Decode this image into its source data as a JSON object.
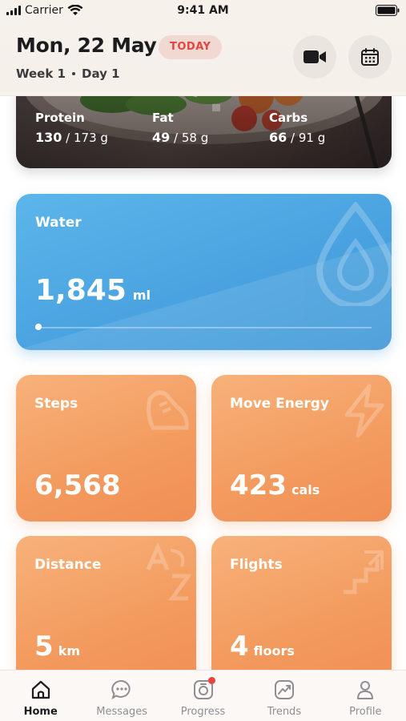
{
  "status_bar": {
    "carrier": "Carrier",
    "time": "9:41 AM"
  },
  "header": {
    "date": "Mon, 22 May",
    "today_badge": "TODAY",
    "week": "Week 1",
    "day": "Day 1"
  },
  "macros": [
    {
      "label": "Protein",
      "value": "130",
      "target": " / 173 g"
    },
    {
      "label": "Fat",
      "value": "49",
      "target": " / 58 g"
    },
    {
      "label": "Carbs",
      "value": "66",
      "target": " / 91 g"
    }
  ],
  "water": {
    "title": "Water",
    "value": "1,845",
    "unit": "ml",
    "progress": 0.01
  },
  "stats": {
    "steps": {
      "title": "Steps",
      "value": "6,568",
      "unit": ""
    },
    "move_energy": {
      "title": "Move Energy",
      "value": "423",
      "unit": "cals"
    },
    "distance": {
      "title": "Distance",
      "value": "5",
      "unit": "km"
    },
    "flights": {
      "title": "Flights",
      "value": "4",
      "unit": "floors"
    }
  },
  "tabs": [
    {
      "label": "Home",
      "icon": "home-icon",
      "active": true
    },
    {
      "label": "Messages",
      "icon": "messages-icon",
      "active": false
    },
    {
      "label": "Progress",
      "icon": "progress-icon",
      "active": false,
      "notification": true
    },
    {
      "label": "Trends",
      "icon": "trends-icon",
      "active": false
    },
    {
      "label": "Profile",
      "icon": "profile-icon",
      "active": false
    }
  ],
  "colors": {
    "water": "#4aa3e0",
    "activity": "#f39a5e",
    "today_badge_text": "#e0473e",
    "today_badge_bg": "#f2d8d3"
  }
}
